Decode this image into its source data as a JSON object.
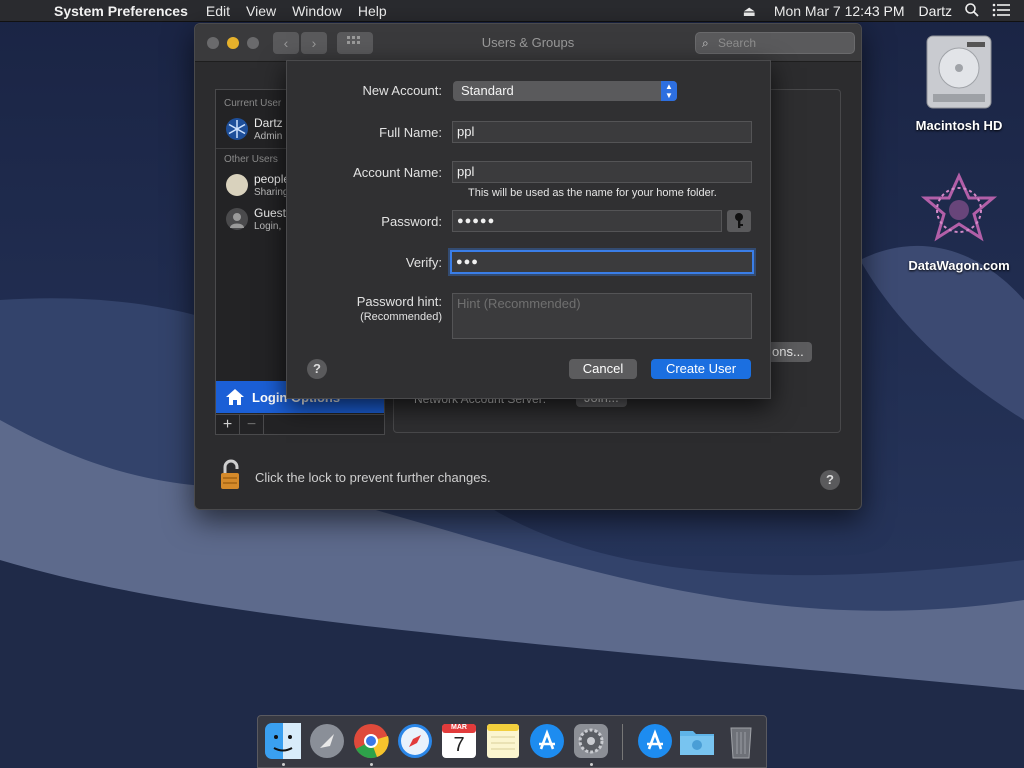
{
  "menubar": {
    "app_name": "System Preferences",
    "items": [
      "Edit",
      "View",
      "Window",
      "Help"
    ],
    "datetime": "Mon Mar 7  12:43 PM",
    "user": "Dartz"
  },
  "desktop": {
    "icons": [
      {
        "label": "Macintosh HD"
      },
      {
        "label": "DataWagon.com"
      }
    ]
  },
  "window": {
    "title": "Users & Groups",
    "search_placeholder": "Search",
    "sidebar": {
      "current_header": "Current User",
      "other_header": "Other Users",
      "users": [
        {
          "name": "Dartz",
          "sub": "Admin"
        },
        {
          "name": "people",
          "sub": "Sharing"
        },
        {
          "name": "Guest",
          "sub": "Login,"
        }
      ],
      "login_options": "Login Options"
    },
    "panel": {
      "options_btn": "ons...",
      "network_label": "Network Account Server:",
      "join_btn": "Join..."
    },
    "lock_text": "Click the lock to prevent further changes."
  },
  "sheet": {
    "new_account_label": "New Account:",
    "account_type": "Standard",
    "full_name_label": "Full Name:",
    "full_name_value": "ppl",
    "account_name_label": "Account Name:",
    "account_name_value": "ppl",
    "home_note": "This will be used as the name for your home folder.",
    "password_label": "Password:",
    "password_value": "●●●●●",
    "verify_label": "Verify:",
    "verify_value": "●●●",
    "hint_label": "Password hint:",
    "hint_sub": "(Recommended)",
    "hint_placeholder": "Hint (Recommended)",
    "help": "?",
    "cancel": "Cancel",
    "create": "Create User"
  },
  "dock": {
    "calendar_month": "MAR",
    "calendar_day": "7"
  },
  "colors": {
    "accent": "#1b5fd6",
    "focus_ring": "#3a7ee8"
  }
}
